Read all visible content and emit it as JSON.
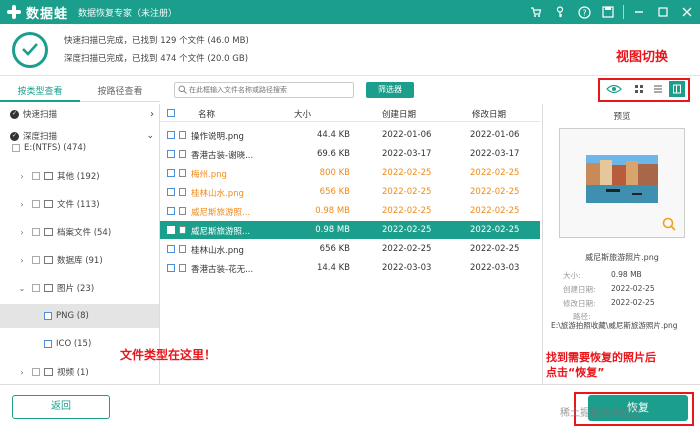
{
  "app": {
    "brand": "数据蛙",
    "name": "数据恢复专家（未注册）"
  },
  "summary": {
    "quick": "快速扫描已完成，已找到 129 个文件 (46.0 MB)",
    "deep": "深度扫描已完成，已找到 474 个文件 (20.0 GB)"
  },
  "tabs": {
    "by_type": "按类型查看",
    "by_path": "按路径查看"
  },
  "toolbar": {
    "search_placeholder": "在此框输入文件名称或路径搜索",
    "filter_label": "筛选器"
  },
  "annotations": {
    "view_switch": "视图切换",
    "file_type": "文件类型在这里！",
    "recover_line1": "找到需要恢复的照片后",
    "recover_line2": "点击“恢复”"
  },
  "tree": {
    "quick_scan": "快速扫描",
    "deep_scan": "深度扫描",
    "drive": "E:(NTFS) (474)",
    "items": [
      "其他 (192)",
      "文件 (113)",
      "档案文件 (54)",
      "数据库 (91)",
      "图片 (23)",
      "PNG (8)",
      "ICO (15)",
      "视频 (1)"
    ]
  },
  "list": {
    "headers": {
      "name": "名称",
      "size": "大小",
      "created": "创建日期",
      "modified": "修改日期"
    },
    "rows": [
      {
        "name": "操作说明.png",
        "size": "44.4 KB",
        "created": "2022-01-06",
        "modified": "2022-01-06"
      },
      {
        "name": "香港古装-谢晓...",
        "size": "69.6 KB",
        "created": "2022-03-17",
        "modified": "2022-03-17"
      },
      {
        "name": "梅州.png",
        "size": "800 KB",
        "created": "2022-02-25",
        "modified": "2022-02-25"
      },
      {
        "name": "桂林山水.png",
        "size": "656 KB",
        "created": "2022-02-25",
        "modified": "2022-02-25"
      },
      {
        "name": "威尼斯旅游照...",
        "size": "0.98 MB",
        "created": "2022-02-25",
        "modified": "2022-02-25"
      },
      {
        "name": "威尼斯旅游照...",
        "size": "0.98 MB",
        "created": "2022-02-25",
        "modified": "2022-02-25"
      },
      {
        "name": "桂林山水.png",
        "size": "656 KB",
        "created": "2022-02-25",
        "modified": "2022-02-25"
      },
      {
        "name": "香港古装-花无...",
        "size": "14.4 KB",
        "created": "2022-03-03",
        "modified": "2022-03-03"
      }
    ]
  },
  "preview": {
    "title": "预览",
    "filename": "威尼斯旅游照片.png",
    "size_label": "大小:",
    "size": "0.98 MB",
    "created_label": "创建日期:",
    "created": "2022-02-25",
    "modified_label": "修改日期:",
    "modified": "2022-02-25",
    "path_label": "路径:",
    "path": "E:\\旅游拍照收藏\\威尼斯旅游照片.png"
  },
  "footer": {
    "back": "返回",
    "recover": "恢复"
  },
  "watermark": "稀土掘金技术社区",
  "colors": {
    "accent": "#1b9e8c",
    "annotation": "#e8151b",
    "orange_text": "#f08a18"
  }
}
